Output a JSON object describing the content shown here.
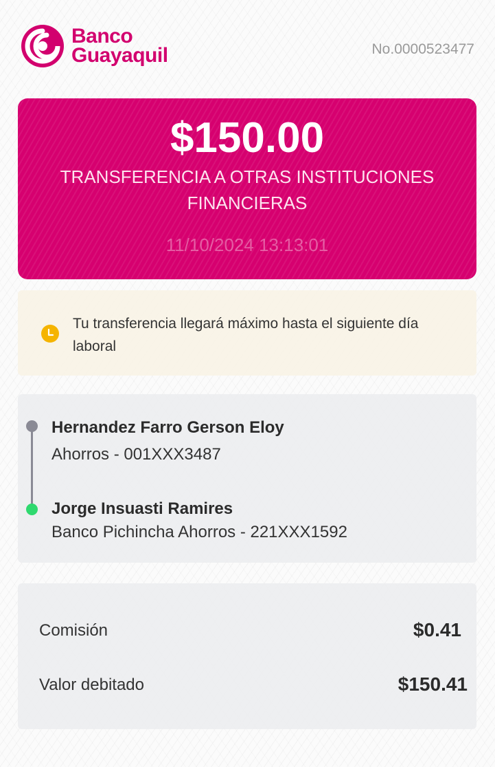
{
  "header": {
    "brand_line1": "Banco",
    "brand_line2": "Guayaquil",
    "receipt_number": "No.0000523477"
  },
  "transaction": {
    "amount": "$150.00",
    "type": "TRANSFERENCIA A OTRAS INSTITUCIONES FINANCIERAS",
    "datetime": "11/10/2024 13:13:01"
  },
  "notice": {
    "icon": "clock-icon",
    "text": "Tu transferencia llegará máximo hasta el siguiente día laboral"
  },
  "sender": {
    "name": "Hernandez Farro Gerson Eloy",
    "account": "Ahorros - 001XXX3487"
  },
  "recipient": {
    "name": "Jorge Insuasti Ramires",
    "account": "Banco Pichincha Ahorros - 221XXX1592"
  },
  "totals": {
    "commission_label": "Comisión",
    "commission_value": "$0.41",
    "debited_label": "Valor debitado",
    "debited_value": "$150.41"
  },
  "colors": {
    "brand": "#d6006f",
    "notice_bg": "#f9f3e6",
    "recipient_dot": "#2fd96f",
    "sender_dot": "#8a8a95",
    "clock": "#f5b400"
  }
}
